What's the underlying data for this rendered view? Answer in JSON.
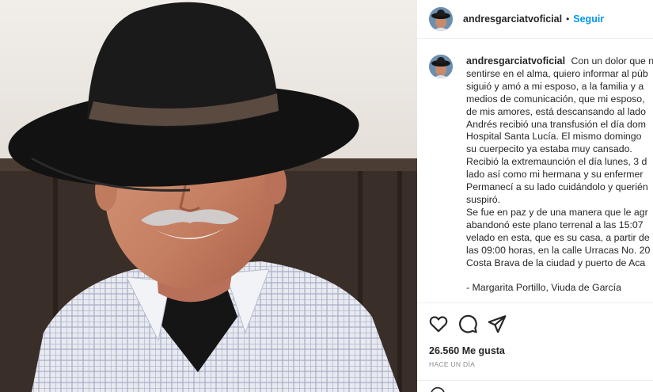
{
  "post": {
    "username": "andresgarciatvoficial",
    "separator": "•",
    "follow_label": "Seguir",
    "caption_lines": [
      "Con un dolor que n",
      "sentirse en el alma, quiero informar al púb",
      "siguió y amó a mi esposo, a la familia y a",
      "medios de comunicación, que mi esposo,",
      "de mis amores, está descansando al lado",
      "Andrés recibió una transfusión el día dom",
      "Hospital Santa Lucía. El mismo domingo",
      "su cuerpecito ya estaba muy cansado.",
      "Recibió la extremaunción el día lunes, 3 d",
      "lado así como mi hermana y su enfermer",
      "Permanecí a su lado cuidándolo y querién",
      "suspiró.",
      "Se fue en paz y de una manera que le agr",
      "abandonó este plano terrenal a las 15:07",
      "velado en esta, que es su casa, a partir de",
      "las 09:00 horas, en la calle Urracas No. 20",
      "Costa Brava de la ciudad y puerto de Aca",
      "",
      "- Margarita Portillo, Viuda de García"
    ],
    "likes_text": "26.560 Me gusta",
    "time_ago": "Hace un día",
    "icons": {
      "like": "heart-icon",
      "comment": "comment-icon",
      "share": "share-icon",
      "emoji": "emoji-icon"
    }
  },
  "colors": {
    "follow": "#0095f6",
    "text": "#262626",
    "muted": "#8e8e8e",
    "border": "#efefef"
  }
}
